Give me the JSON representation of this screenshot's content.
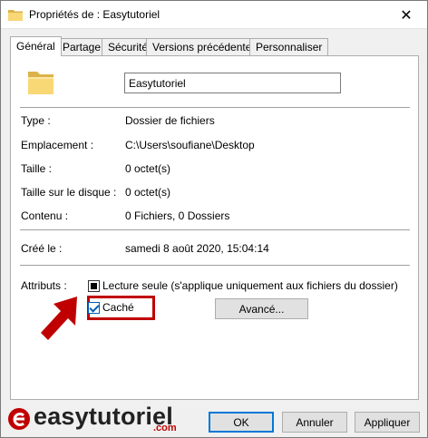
{
  "window": {
    "title": "Propriétés de : Easytutoriel",
    "close_glyph": "✕"
  },
  "tabs": [
    {
      "label": "Général",
      "active": true
    },
    {
      "label": "Partage",
      "active": false
    },
    {
      "label": "Sécurité",
      "active": false
    },
    {
      "label": "Versions précédentes",
      "active": false
    },
    {
      "label": "Personnaliser",
      "active": false
    }
  ],
  "general": {
    "name_value": "Easytutoriel",
    "type_label": "Type :",
    "type_value": "Dossier de fichiers",
    "location_label": "Emplacement :",
    "location_value": "C:\\Users\\soufiane\\Desktop",
    "size_label": "Taille :",
    "size_value": "0 octet(s)",
    "disk_size_label": "Taille sur le disque :",
    "disk_size_value": "0 octet(s)",
    "contents_label": "Contenu :",
    "contents_value": "0 Fichiers, 0 Dossiers",
    "created_label": "Créé le :",
    "created_value": "samedi 8 août 2020, 15:04:14",
    "attributes_label": "Attributs :",
    "readonly_label": "Lecture seule (s'applique uniquement aux fichiers du dossier)",
    "readonly_state": "indeterminate",
    "hidden_label": "Caché",
    "hidden_checked": true,
    "advanced_button": "Avancé..."
  },
  "footer": {
    "ok_label": "OK",
    "cancel_label": "Annuler",
    "apply_label": "Appliquer"
  },
  "watermark": {
    "text": "easytutoriel",
    "suffix": ".com",
    "accent_color": "#c00000"
  },
  "colors": {
    "highlight_box": "#c00000",
    "folder_yellow": "#f8d775",
    "checkbox_blue": "#005fb8"
  },
  "icons": {
    "title_icon": "folder-icon",
    "big_icon": "folder-icon",
    "arrow": "red-arrow-icon"
  }
}
